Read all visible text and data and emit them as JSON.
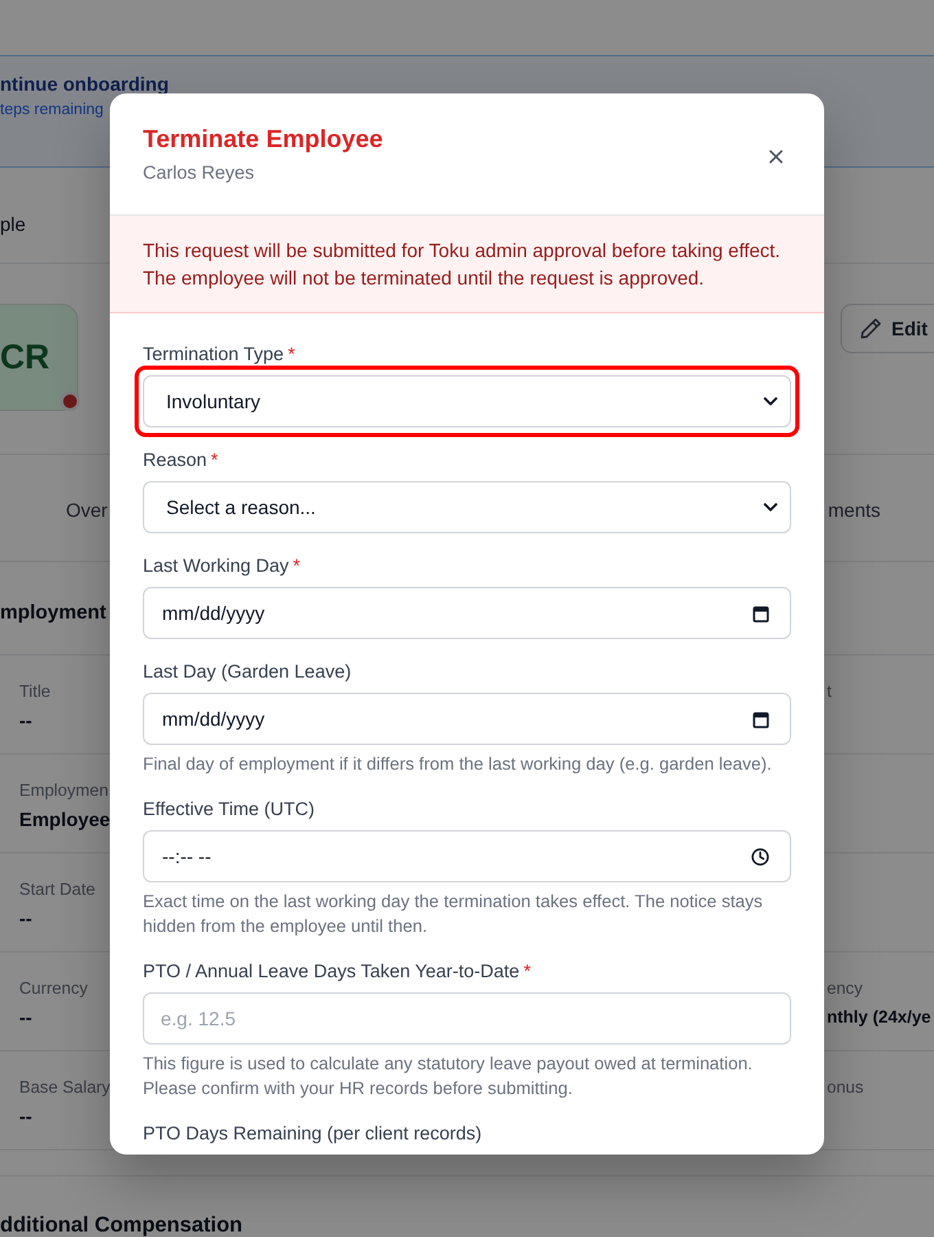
{
  "page": {
    "banner": {
      "title": "ntinue onboarding",
      "subtitle": "teps remaining"
    },
    "breadcrumb": "ple",
    "profile": {
      "initials": "CR",
      "edit_button": "Edit"
    },
    "tabs": [
      {
        "label": "Over",
        "selected": false
      },
      {
        "label": "ments",
        "selected": false
      }
    ],
    "section_title": "mployment",
    "rows": [
      {
        "label": "Title",
        "value": "--",
        "right_label": "t"
      },
      {
        "label": "Employmen",
        "value": "Employee"
      },
      {
        "label": "Start Date",
        "value": "--"
      },
      {
        "label": "Currency",
        "value": "--",
        "right_label": "ency",
        "right_value": "nthly (24x/ye"
      },
      {
        "label": "Base Salary",
        "value": "--",
        "right_label": "onus"
      }
    ],
    "next_section_title": "dditional Compensation"
  },
  "modal": {
    "title": "Terminate Employee",
    "subtitle": "Carlos Reyes",
    "notice": "This request will be submitted for Toku admin approval before taking effect. The employee will not be terminated until the request is approved.",
    "required_mark": "*",
    "fields": [
      {
        "kind": "select",
        "label": "Termination Type",
        "required": true,
        "value": "Involuntary",
        "highlighted": true
      },
      {
        "kind": "select",
        "label": "Reason",
        "required": true,
        "value": "Select a reason..."
      },
      {
        "kind": "date",
        "label": "Last Working Day",
        "required": true,
        "placeholder": "mm/dd/yyyy"
      },
      {
        "kind": "date",
        "label": "Last Day (Garden Leave)",
        "required": false,
        "placeholder": "mm/dd/yyyy",
        "help": "Final day of employment if it differs from the last working day (e.g. garden leave)."
      },
      {
        "kind": "time",
        "label": "Effective Time (UTC)",
        "required": false,
        "placeholder": "--:-- --",
        "help": "Exact time on the last working day the termination takes effect. The notice stays hidden from the employee until then."
      },
      {
        "kind": "number",
        "label": "PTO / Annual Leave Days Taken Year-to-Date",
        "required": true,
        "placeholder": "e.g. 12.5",
        "help": "This figure is used to calculate any statutory leave payout owed at termination. Please confirm with your HR records before submitting."
      },
      {
        "kind": "label",
        "label": "PTO Days Remaining (per client records)",
        "required": false
      }
    ]
  }
}
